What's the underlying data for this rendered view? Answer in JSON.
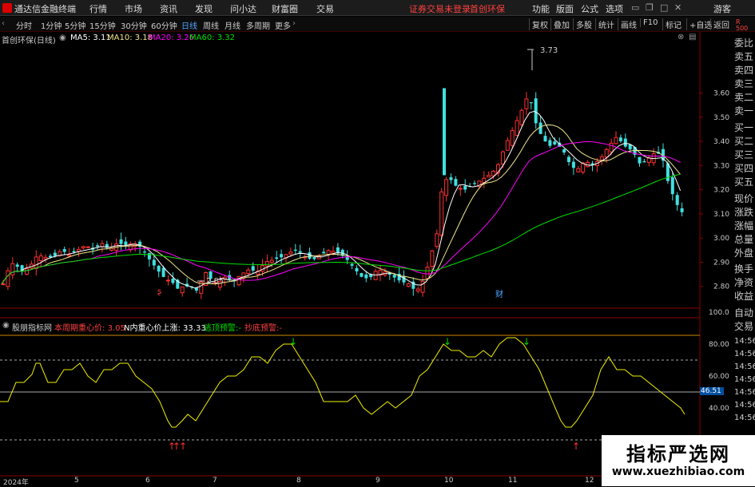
{
  "app": {
    "title": "通达信金融终端",
    "trade_notice": "证券交易未登录",
    "stock_name_top": "首创环保"
  },
  "menu": [
    "行情",
    "市场",
    "资讯",
    "发现",
    "问小达",
    "财富圈",
    "交易"
  ],
  "menu_right": [
    "功能",
    "版面",
    "公式",
    "选项",
    "游客"
  ],
  "periods": [
    "分时",
    "1分钟",
    "5分钟",
    "15分钟",
    "30分钟",
    "60分钟",
    "日线",
    "周线",
    "月线",
    "多周期",
    "更多"
  ],
  "right_tools": [
    "复权",
    "叠加",
    "多股",
    "统计",
    "画线",
    "F10",
    "标记",
    "+自选",
    "返回"
  ],
  "main_chart": {
    "title": "首创环保(日线)",
    "ma": [
      {
        "name": "MA5",
        "value": "3.11",
        "color": "#ffffff"
      },
      {
        "name": "MA10",
        "value": "3.18",
        "color": "#f0e68c"
      },
      {
        "name": "MA20",
        "value": "3.26",
        "color": "#ff00ff"
      },
      {
        "name": "MA60",
        "value": "3.32",
        "color": "#00e000"
      }
    ],
    "high_label": "3.73",
    "low_label": "2.85",
    "marker_cai": "财"
  },
  "indicator": {
    "name": "股朋指标网",
    "line1_label": "本周期重心价:",
    "line1_value": "3.05",
    "line2_label": "N内重心价上涨:",
    "line2_value": "33.33",
    "line3": "逃顶预警:",
    "line3_value": "-",
    "line4": "抄底预警:",
    "line4_value": "-",
    "current": "46.51"
  },
  "right_panel": [
    "委比",
    "卖五",
    "卖四",
    "卖三",
    "卖二",
    "卖一",
    "买一",
    "买二",
    "买三",
    "买四",
    "买五",
    "现价",
    "涨跌",
    "涨幅",
    "总量",
    "外盘",
    "换手",
    "净资",
    "收益",
    "自动",
    "交易"
  ],
  "right_badge": {
    "line1": "R",
    "line2": "500"
  },
  "times": [
    "14:56",
    "14:56",
    "14:56",
    "14:56",
    "14:56",
    "14:56",
    "14:56"
  ],
  "xaxis": [
    "2024年",
    "5",
    "6",
    "7",
    "8",
    "9",
    "10",
    "11",
    "12"
  ],
  "watermark": {
    "cn": "指标严选网",
    "en": "www.xuezhibiao.com"
  },
  "chart_data": [
    {
      "type": "candlestick",
      "title": "首创环保(日线)",
      "ylim": [
        2.7,
        3.78
      ],
      "yticks": [
        "3.60",
        "3.50",
        "3.40",
        "3.30",
        "3.20",
        "3.10",
        "3.00",
        "2.90",
        "2.80"
      ],
      "annotations": [
        {
          "text": "3.73",
          "type": "high"
        },
        {
          "text": "2.85",
          "type": "low"
        }
      ],
      "points": [
        [
          0,
          2.79
        ],
        [
          7,
          2.86
        ],
        [
          15,
          2.9
        ],
        [
          25,
          2.86
        ],
        [
          35,
          2.88
        ],
        [
          45,
          2.93
        ],
        [
          55,
          2.92
        ],
        [
          65,
          2.92
        ],
        [
          75,
          2.95
        ],
        [
          85,
          2.93
        ],
        [
          95,
          2.95
        ],
        [
          105,
          2.97
        ],
        [
          115,
          2.95
        ],
        [
          125,
          2.98
        ],
        [
          135,
          2.95
        ],
        [
          145,
          2.98
        ],
        [
          155,
          2.97
        ],
        [
          165,
          2.98
        ],
        [
          175,
          2.96
        ],
        [
          183,
          2.92
        ],
        [
          190,
          2.89
        ],
        [
          197,
          2.86
        ],
        [
          205,
          2.83
        ],
        [
          213,
          2.82
        ],
        [
          220,
          2.79
        ],
        [
          228,
          2.8
        ],
        [
          236,
          2.8
        ],
        [
          245,
          2.78
        ],
        [
          255,
          2.86
        ],
        [
          262,
          2.83
        ],
        [
          270,
          2.81
        ],
        [
          280,
          2.84
        ],
        [
          290,
          2.82
        ],
        [
          300,
          2.85
        ],
        [
          310,
          2.87
        ],
        [
          320,
          2.86
        ],
        [
          330,
          2.9
        ],
        [
          340,
          2.91
        ],
        [
          350,
          2.92
        ],
        [
          360,
          2.94
        ],
        [
          370,
          2.95
        ],
        [
          380,
          2.92
        ],
        [
          390,
          2.91
        ],
        [
          400,
          2.93
        ],
        [
          410,
          2.95
        ],
        [
          420,
          2.94
        ],
        [
          430,
          2.92
        ],
        [
          440,
          2.88
        ],
        [
          450,
          2.84
        ],
        [
          460,
          2.83
        ],
        [
          465,
          2.85
        ],
        [
          470,
          2.87
        ],
        [
          480,
          2.86
        ],
        [
          490,
          2.84
        ],
        [
          500,
          2.82
        ],
        [
          510,
          2.81
        ],
        [
          518,
          2.78
        ],
        [
          525,
          2.8
        ],
        [
          535,
          2.9
        ],
        [
          545,
          3.02
        ],
        [
          552,
          3.23
        ],
        [
          560,
          3.25
        ],
        [
          570,
          3.21
        ],
        [
          580,
          3.2
        ],
        [
          590,
          3.22
        ],
        [
          600,
          3.24
        ],
        [
          610,
          3.26
        ],
        [
          620,
          3.29
        ],
        [
          630,
          3.38
        ],
        [
          640,
          3.45
        ],
        [
          650,
          3.52
        ],
        [
          660,
          3.6
        ],
        [
          668,
          3.48
        ],
        [
          676,
          3.42
        ],
        [
          685,
          3.38
        ],
        [
          695,
          3.39
        ],
        [
          705,
          3.35
        ],
        [
          712,
          3.3
        ],
        [
          720,
          3.28
        ],
        [
          730,
          3.32
        ],
        [
          740,
          3.3
        ],
        [
          750,
          3.33
        ],
        [
          760,
          3.38
        ],
        [
          770,
          3.42
        ],
        [
          780,
          3.38
        ],
        [
          790,
          3.36
        ],
        [
          800,
          3.3
        ],
        [
          810,
          3.33
        ],
        [
          820,
          3.36
        ],
        [
          828,
          3.32
        ],
        [
          835,
          3.22
        ],
        [
          845,
          3.14
        ],
        [
          855,
          3.09
        ]
      ]
    },
    {
      "type": "line",
      "title": "股朋指标网",
      "ylim": [
        20,
        100
      ],
      "yticks": [
        "100.0",
        "80.00",
        "60.00",
        "40.00"
      ],
      "points": [
        [
          0,
          44
        ],
        [
          10,
          44
        ],
        [
          20,
          56
        ],
        [
          30,
          56
        ],
        [
          40,
          61
        ],
        [
          45,
          68
        ],
        [
          50,
          68
        ],
        [
          60,
          56
        ],
        [
          70,
          56
        ],
        [
          80,
          64
        ],
        [
          90,
          64
        ],
        [
          100,
          68
        ],
        [
          110,
          60
        ],
        [
          120,
          56
        ],
        [
          130,
          64
        ],
        [
          140,
          64
        ],
        [
          150,
          68
        ],
        [
          160,
          68
        ],
        [
          170,
          60
        ],
        [
          180,
          56
        ],
        [
          190,
          52
        ],
        [
          200,
          44
        ],
        [
          210,
          32
        ],
        [
          215,
          28
        ],
        [
          220,
          28
        ],
        [
          228,
          32
        ],
        [
          235,
          36
        ],
        [
          245,
          32
        ],
        [
          255,
          40
        ],
        [
          265,
          48
        ],
        [
          275,
          56
        ],
        [
          285,
          60
        ],
        [
          295,
          60
        ],
        [
          305,
          64
        ],
        [
          315,
          72
        ],
        [
          325,
          72
        ],
        [
          335,
          68
        ],
        [
          345,
          76
        ],
        [
          355,
          80
        ],
        [
          365,
          80
        ],
        [
          375,
          72
        ],
        [
          385,
          64
        ],
        [
          395,
          56
        ],
        [
          405,
          44
        ],
        [
          415,
          44
        ],
        [
          425,
          44
        ],
        [
          435,
          44
        ],
        [
          445,
          48
        ],
        [
          455,
          40
        ],
        [
          465,
          36
        ],
        [
          475,
          40
        ],
        [
          485,
          44
        ],
        [
          495,
          40
        ],
        [
          505,
          44
        ],
        [
          515,
          48
        ],
        [
          525,
          60
        ],
        [
          535,
          64
        ],
        [
          545,
          72
        ],
        [
          555,
          80
        ],
        [
          565,
          76
        ],
        [
          575,
          76
        ],
        [
          585,
          72
        ],
        [
          595,
          72
        ],
        [
          605,
          76
        ],
        [
          615,
          72
        ],
        [
          625,
          80
        ],
        [
          635,
          84
        ],
        [
          645,
          84
        ],
        [
          655,
          80
        ],
        [
          665,
          72
        ],
        [
          675,
          64
        ],
        [
          685,
          52
        ],
        [
          695,
          40
        ],
        [
          702,
          32
        ],
        [
          708,
          28
        ],
        [
          715,
          28
        ],
        [
          722,
          32
        ],
        [
          732,
          40
        ],
        [
          742,
          48
        ],
        [
          752,
          64
        ],
        [
          762,
          72
        ],
        [
          772,
          64
        ],
        [
          782,
          64
        ],
        [
          792,
          60
        ],
        [
          802,
          60
        ],
        [
          812,
          56
        ],
        [
          822,
          52
        ],
        [
          832,
          48
        ],
        [
          842,
          44
        ],
        [
          852,
          40
        ],
        [
          857,
          36
        ]
      ]
    }
  ]
}
